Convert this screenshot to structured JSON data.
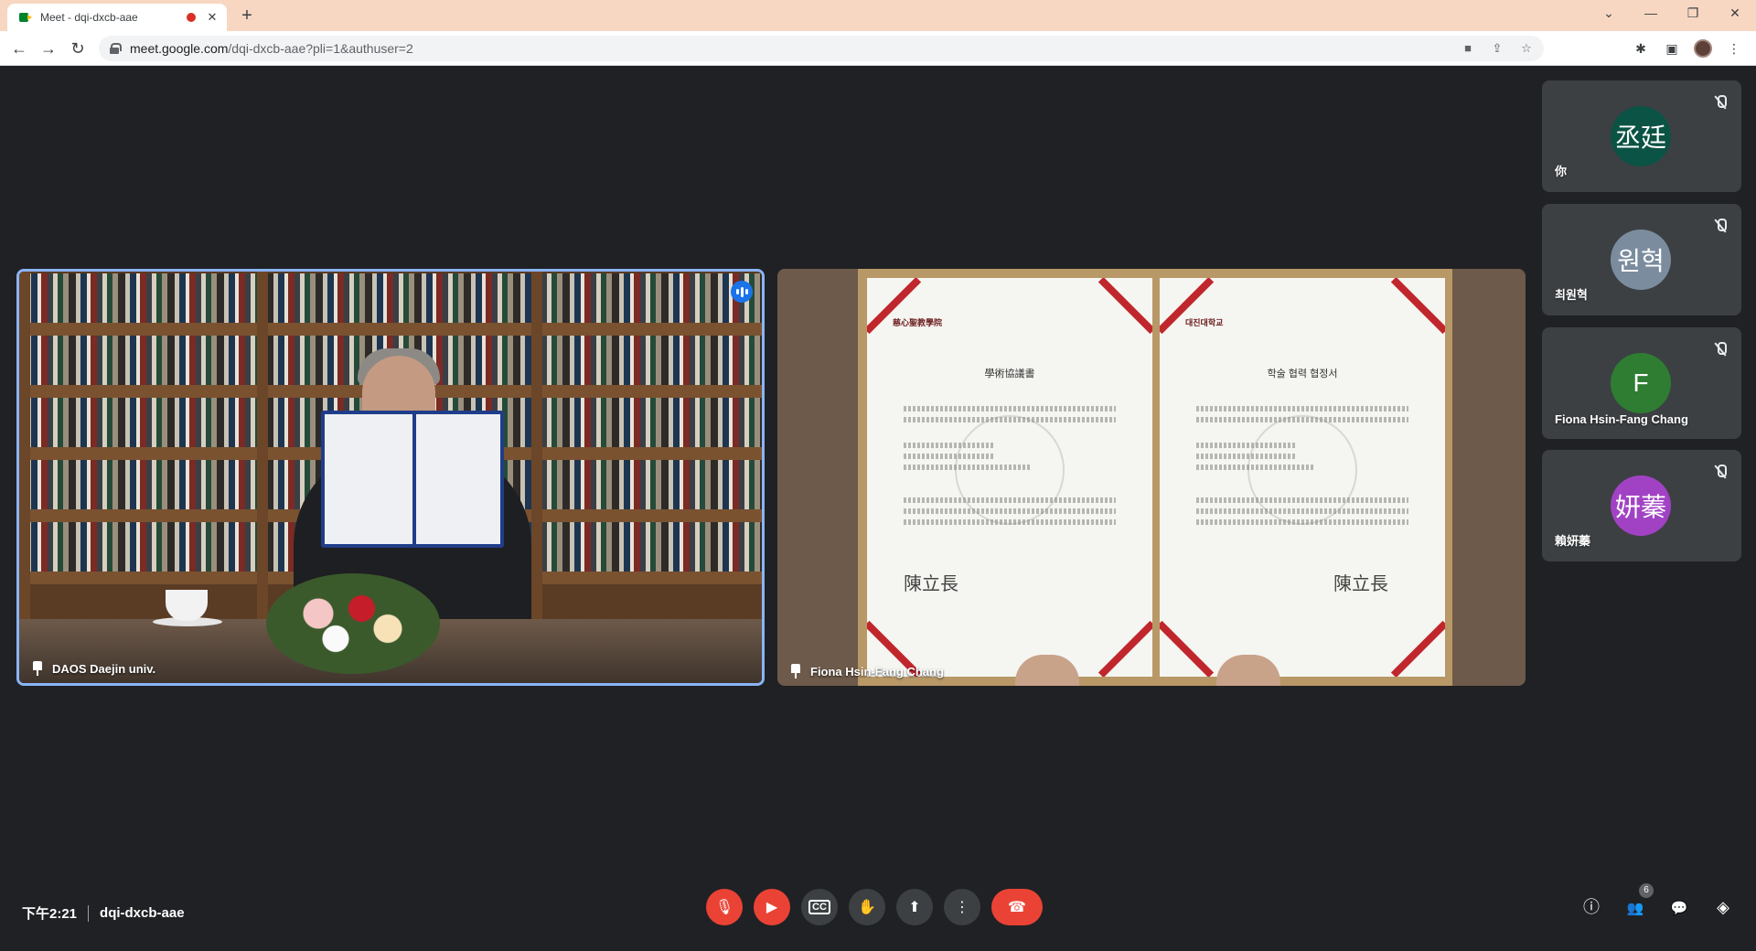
{
  "browser": {
    "tab_title": "Meet - dqi-dxcb-aae",
    "tab_close": "✕",
    "new_tab": "+",
    "url_host": "meet.google.com",
    "url_path": "/dqi-dxcb-aae?pli=1&authuser=2",
    "window_controls": {
      "collapse": "⌄",
      "minimize": "—",
      "restore": "❐",
      "close": "✕"
    },
    "nav": {
      "back": "←",
      "forward": "→",
      "reload": "↻"
    },
    "omni_icons": {
      "camera": "■",
      "share": "⇪",
      "bookmark": "☆"
    },
    "ext_icons": {
      "extensions": "✱",
      "side_panel": "▣",
      "menu": "⋮"
    }
  },
  "tiles": [
    {
      "name": "DAOS Daejin univ.",
      "speaking": true
    },
    {
      "name": "Fiona Hsin-Fang Chang",
      "document": {
        "left_heading": "學術協議書",
        "right_heading": "학술 협력 협정서",
        "left_logo": "慈心聖教學院",
        "right_logo": "대진대학교",
        "left_sign": "陳立長",
        "right_sign": "陳立長"
      }
    }
  ],
  "participants": [
    {
      "name": "你",
      "avatar_text": "丞廷",
      "avatar_color": "#0b5344",
      "muted": true
    },
    {
      "name": "최원혁",
      "avatar_text": "원혁",
      "avatar_color": "#7b8c9e",
      "muted": true
    },
    {
      "name": "Fiona Hsin-Fang Chang",
      "avatar_text": "F",
      "avatar_color": "#2e7d32",
      "muted": true
    },
    {
      "name": "賴妍蓁",
      "avatar_text": "妍蓁",
      "avatar_color": "#a142c4",
      "muted": true
    }
  ],
  "meeting": {
    "time": "下午2:21",
    "code": "dqi-dxcb-aae",
    "participant_count": "6"
  },
  "controls": {
    "mic": "🎙",
    "camera": "▶",
    "captions": "CC",
    "raise_hand": "✋",
    "present": "⬆",
    "more": "⋮",
    "end_call": "☎"
  },
  "right_tools": {
    "info": "ⓘ",
    "people": "👥",
    "chat": "💬",
    "activities": "◈"
  },
  "colors": {
    "background": "#202124",
    "tile": "#3c4043",
    "accent": "#8ab4f8",
    "danger": "#ea4335"
  }
}
